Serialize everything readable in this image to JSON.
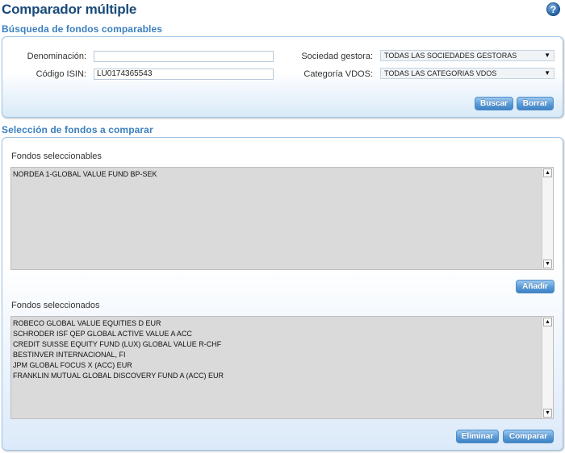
{
  "page": {
    "title": "Comparador múltiple",
    "help_icon": "?"
  },
  "search": {
    "section_title": "Búsqueda de fondos comparables",
    "denominacion_label": "Denominación:",
    "denominacion_value": "",
    "isin_label": "Código ISIN:",
    "isin_value": "LU0174365543",
    "sociedad_label": "Sociedad gestora:",
    "sociedad_selected": "TODAS LAS SOCIEDADES GESTORAS",
    "categoria_label": "Categoría VDOS:",
    "categoria_selected": "TODAS LAS CATEGORIAS VDOS",
    "buscar_label": "Buscar",
    "borrar_label": "Borrar",
    "dropdown_arrow": "▼"
  },
  "selection": {
    "section_title": "Selección de fondos a comparar",
    "selectable_label": "Fondos seleccionables",
    "selectable_items": [
      "NORDEA 1-GLOBAL VALUE FUND BP-SEK"
    ],
    "anadir_label": "Añadir",
    "selected_label": "Fondos seleccionados",
    "selected_items": [
      "ROBECO GLOBAL VALUE EQUITIES D EUR",
      "SCHRODER ISF QEP GLOBAL ACTIVE VALUE A ACC",
      "CREDIT SUISSE EQUITY FUND (LUX) GLOBAL VALUE R-CHF",
      "BESTINVER INTERNACIONAL, FI",
      "JPM GLOBAL FOCUS X (ACC) EUR",
      "FRANKLIN MUTUAL GLOBAL DISCOVERY FUND A (ACC) EUR"
    ],
    "eliminar_label": "Eliminar",
    "comparar_label": "Comparar",
    "scroll_up": "▲",
    "scroll_down": "▼"
  },
  "colors": {
    "title": "#1a4a7a",
    "section_title": "#3b7fbf",
    "panel_border": "#9fc3e3",
    "button": "#5b9bd6",
    "listbox_bg": "#dadada"
  }
}
